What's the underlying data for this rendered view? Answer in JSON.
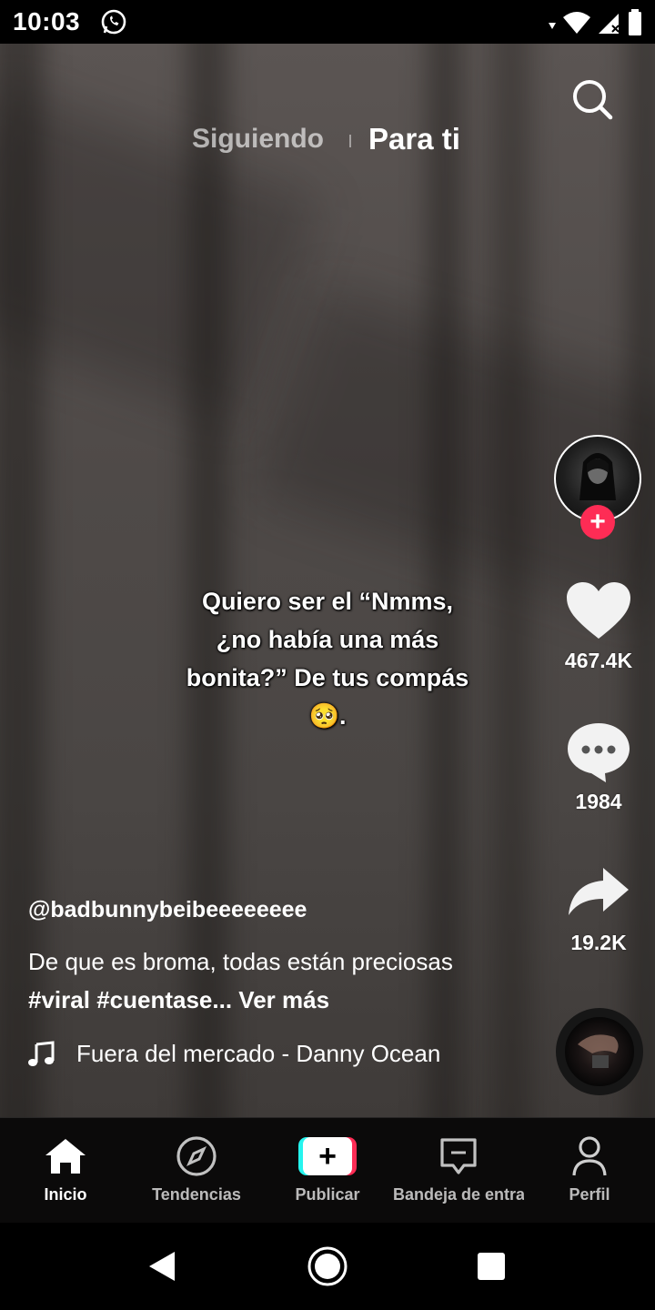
{
  "status_bar": {
    "time": "10:03",
    "icons": [
      "whatsapp-icon",
      "wifi-icon",
      "signal-icon",
      "battery-icon"
    ]
  },
  "top_tabs": {
    "following": "Siguiendo",
    "for_you": "Para ti",
    "active": "Para ti"
  },
  "video": {
    "overlay_text": {
      "line1": "Quiero ser el “Nmms,",
      "line2": "¿no había una más",
      "line3": "bonita?” De tus compás",
      "line4": "🥺."
    }
  },
  "rail": {
    "likes": "467.4K",
    "comments": "1984",
    "shares": "19.2K"
  },
  "post": {
    "username": "@badbunnybeibeeeeeeee",
    "description_text": "De que es broma, todas están preciosas",
    "hashtag1": "#viral",
    "hashtag2": "#cuentase...",
    "see_more": "Ver más",
    "music": "Fuera del mercado - Danny Ocean"
  },
  "bottom_nav": {
    "home": "Inicio",
    "trending": "Tendencias",
    "publish": "Publicar",
    "inbox": "Bandeja de entra",
    "profile": "Perfil",
    "active": "Inicio"
  },
  "colors": {
    "accent_red": "#fe2c55",
    "accent_cyan": "#25f4ee"
  }
}
